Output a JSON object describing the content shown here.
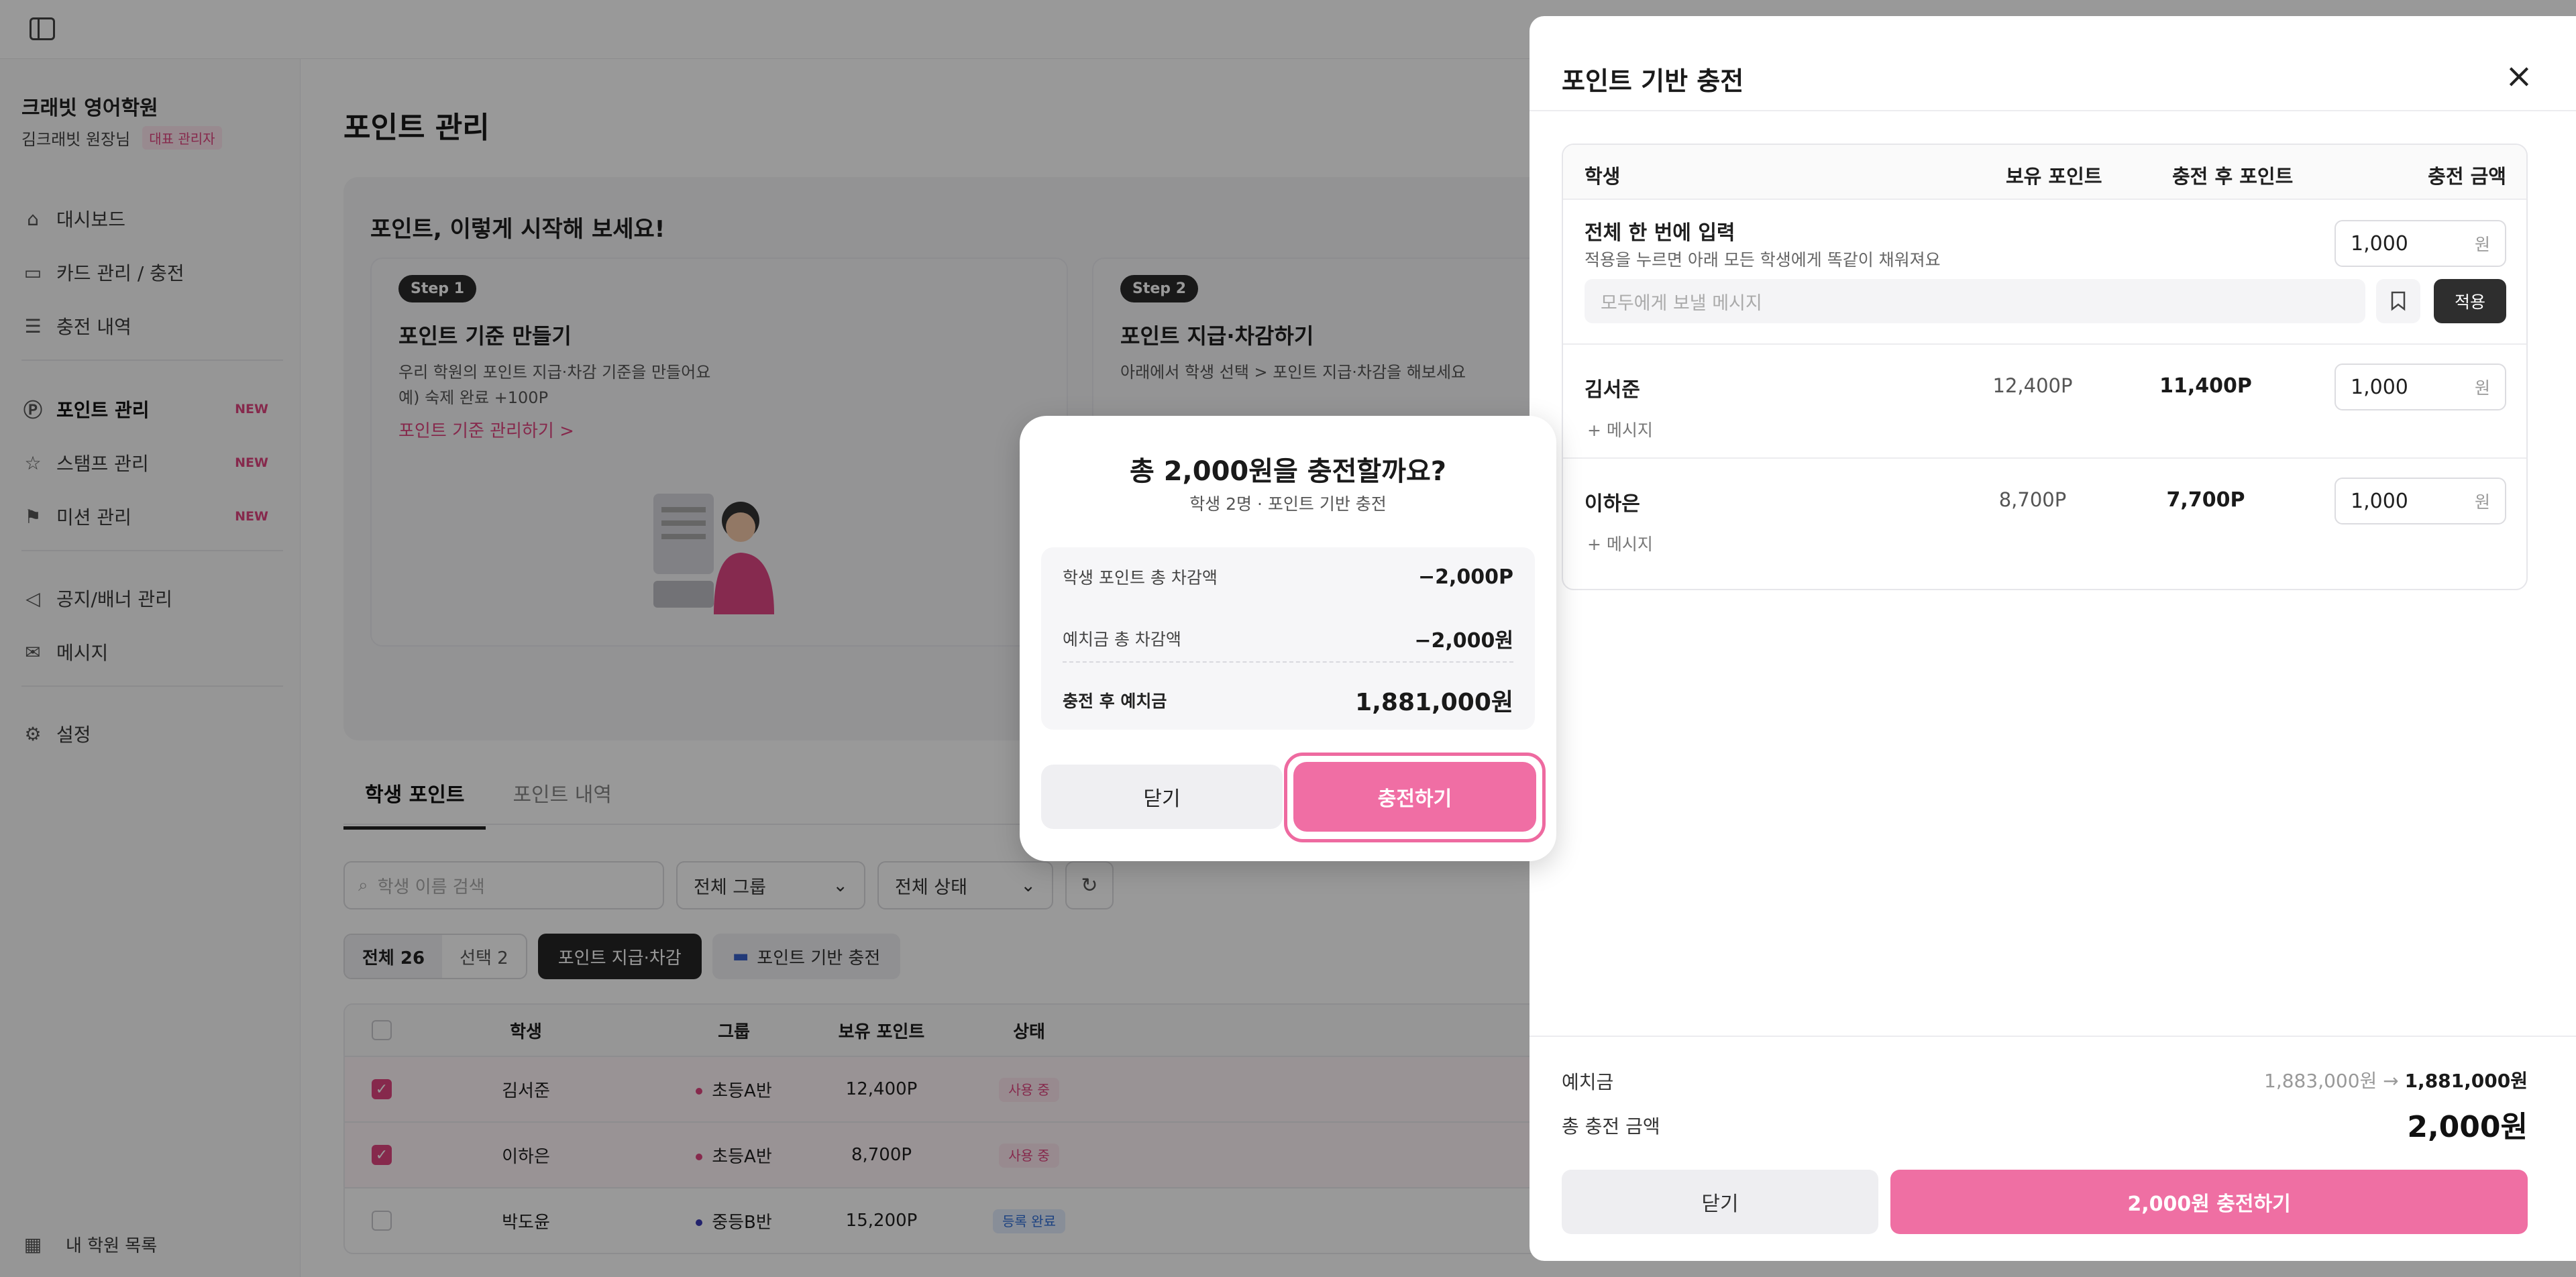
{
  "sidebar": {
    "academy": "크래빗 영어학원",
    "owner": "김크래빗 원장님",
    "owner_badge": "대표 관리자",
    "items": [
      {
        "label": "대시보드",
        "icon": "home-icon",
        "new": ""
      },
      {
        "label": "카드 관리 / 충전",
        "icon": "card-icon",
        "new": ""
      },
      {
        "label": "충전 내역",
        "icon": "receipt-icon",
        "new": ""
      },
      {
        "label": "포인트 관리",
        "icon": "point-icon",
        "new": "NEW"
      },
      {
        "label": "스탬프 관리",
        "icon": "star-icon",
        "new": "NEW"
      },
      {
        "label": "미션 관리",
        "icon": "flag-icon",
        "new": "NEW"
      },
      {
        "label": "공지/배너 관리",
        "icon": "megaphone-icon",
        "new": ""
      },
      {
        "label": "메시지",
        "icon": "mail-icon",
        "new": ""
      },
      {
        "label": "설정",
        "icon": "gear-icon",
        "new": ""
      }
    ],
    "school_list": "내 학원 목록"
  },
  "main": {
    "title": "포인트 관리",
    "guide": {
      "title": "포인트, 이렇게 시작해 보세요!",
      "step1": {
        "chip": "Step 1",
        "title": "포인트 기준 만들기",
        "desc1": "우리 학원의 포인트 지급·차감 기준을 만들어요",
        "desc2": "예) 숙제 완료 +100P",
        "link": "포인트 기준 관리하기 >"
      },
      "step2": {
        "chip": "Step 2",
        "title": "포인트 지급·차감하기",
        "desc1": "아래에서 학생 선택 > 포인트 지급·차감을 해보세요"
      }
    },
    "tabs": [
      "학생 포인트",
      "포인트 내역"
    ],
    "search_placeholder": "학생 이름 검색",
    "group_select": "전체 그룹",
    "status_select": "전체 상태",
    "count_all": "전체 26",
    "count_selected": "선택 2",
    "btn_give": "포인트 지급·차감",
    "btn_charge": "포인트 기반 충전",
    "table_headers": [
      "학생",
      "그룹",
      "보유 포인트",
      "상태"
    ],
    "rows": [
      {
        "name": "김서준",
        "group": "초등A반",
        "points": "12,400P",
        "status": "사용 중",
        "checked": true
      },
      {
        "name": "이하은",
        "group": "초등A반",
        "points": "8,700P",
        "status": "사용 중",
        "checked": true
      },
      {
        "name": "박도윤",
        "group": "중등B반",
        "points": "15,200P",
        "status": "등록 완료",
        "checked": false
      }
    ]
  },
  "drawer": {
    "title": "포인트 기반 충전",
    "headers": {
      "student": "학생",
      "held": "보유 포인트",
      "after": "충전 후 포인트",
      "amount": "충전 금액"
    },
    "bulk": {
      "title": "전체 한 번에 입력",
      "desc": "적용을 누르면 아래 모든 학생에게 똑같이 채워져요",
      "value": "1,000",
      "unit": "원",
      "msg_placeholder": "모두에게 보낼 메시지",
      "apply": "적용"
    },
    "students": [
      {
        "name": "김서준",
        "held": "12,400P",
        "after": "11,400P",
        "amount": "1,000",
        "unit": "원",
        "msg": "+ 메시지"
      },
      {
        "name": "이하은",
        "held": "8,700P",
        "after": "7,700P",
        "amount": "1,000",
        "unit": "원",
        "msg": "+ 메시지"
      }
    ],
    "deposit_label": "예치금",
    "deposit_before": "1,883,000원",
    "deposit_arrow": "→",
    "deposit_after": "1,881,000원",
    "total_label": "총 충전 금액",
    "total_value": "2,000원",
    "close": "닫기",
    "charge": "2,000원 충전하기"
  },
  "modal": {
    "title": "총 2,000원을 충전할까요?",
    "subtitle": "학생 2명 · 포인트 기반 충전",
    "rows": [
      {
        "label": "학생 포인트 총 차감액",
        "value": "−2,000P"
      },
      {
        "label": "예치금 총 차감액",
        "value": "−2,000원"
      }
    ],
    "after_label": "충전 후 예치금",
    "after_value": "1,881,000원",
    "close": "닫기",
    "confirm": "충전하기"
  },
  "colors": {
    "accent": "#f06ea4",
    "brand_pink": "#e0457f",
    "dark": "#262626"
  }
}
